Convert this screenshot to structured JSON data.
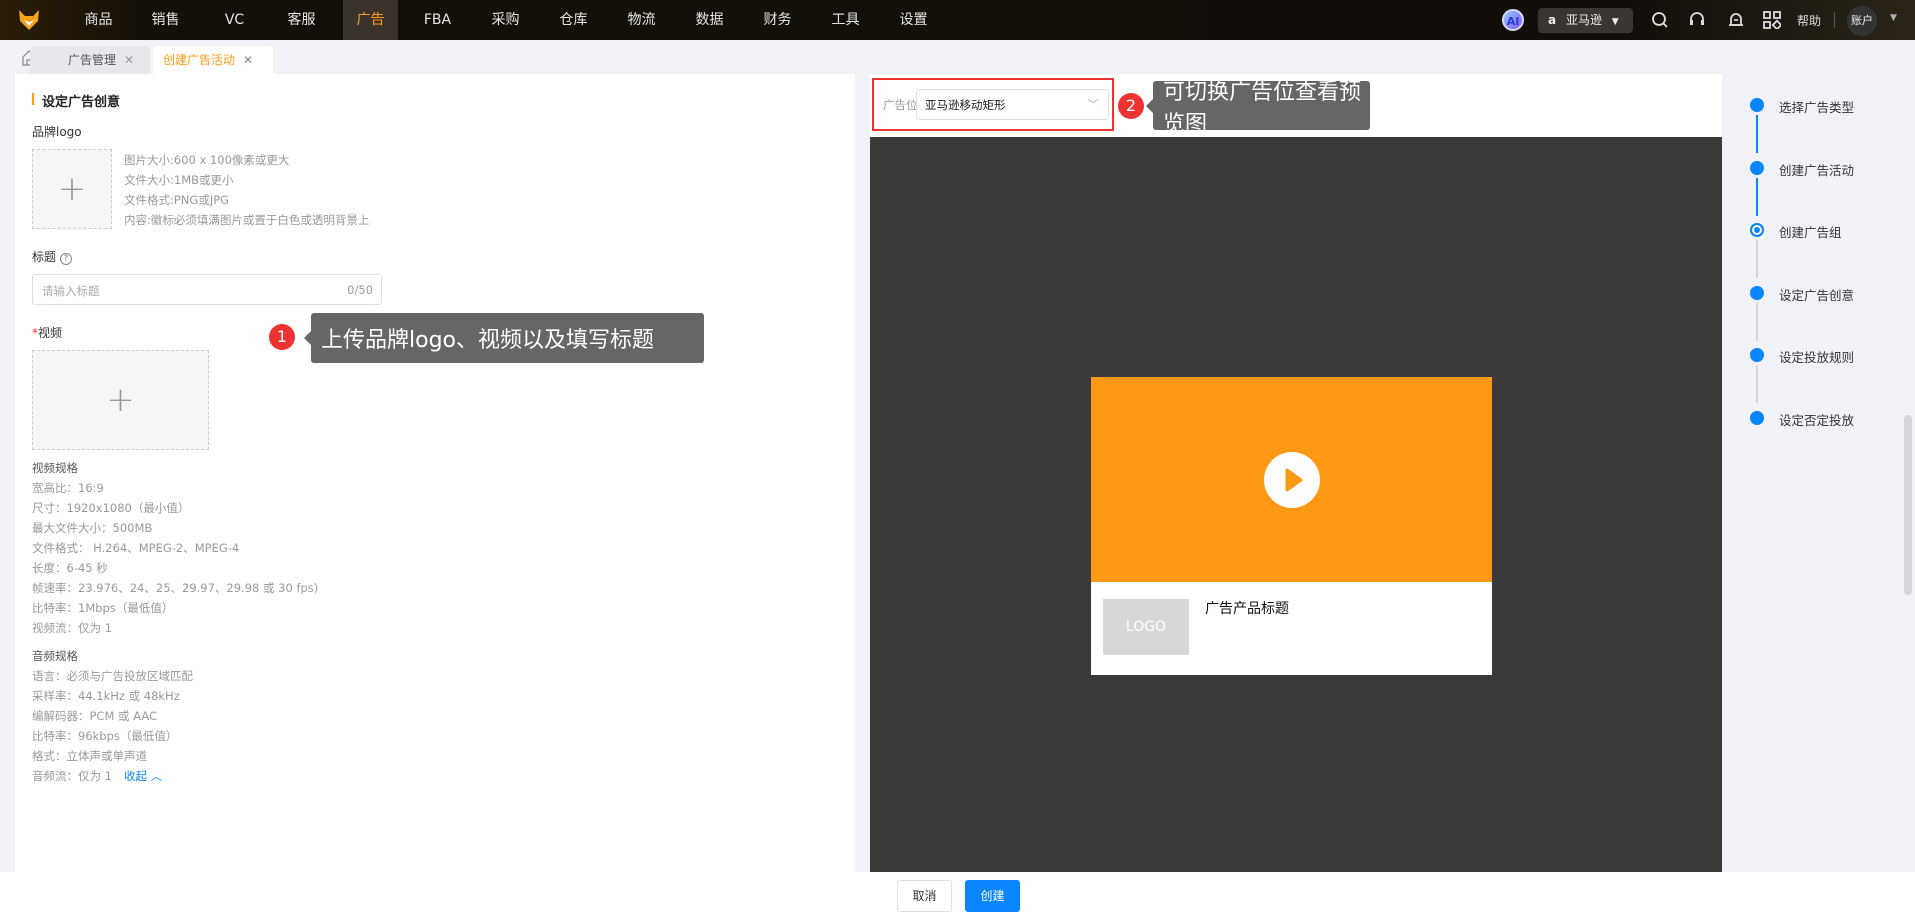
{
  "nav": {
    "items": [
      "商品",
      "销售",
      "VC",
      "客服",
      "广告",
      "FBA",
      "采购",
      "仓库",
      "物流",
      "数据",
      "财务",
      "工具",
      "设置"
    ],
    "active": "广告",
    "ai": "AI",
    "store": "亚马逊",
    "help": "帮助",
    "account": "账户"
  },
  "tabs": [
    {
      "label": "广告管理"
    },
    {
      "label": "创建广告活动"
    }
  ],
  "form": {
    "section_title": "设定广告创意",
    "logo_label": "品牌logo",
    "logo_specs": [
      "图片大小:600 x 100像素或更大",
      "文件大小:1MB或更小",
      "文件格式:PNG或JPG",
      "内容:徽标必须填满图片或置于白色或透明背景上"
    ],
    "title_label": "标题",
    "title_placeholder": "请输入标题",
    "title_count": "0/50",
    "video_required": "*",
    "video_label": "视频",
    "video_spec_title": "视频规格",
    "video_specs": [
      "宽高比：16:9",
      "尺寸：1920x1080（最小值）",
      "最大文件大小：500MB",
      "文件格式： H.264、MPEG-2、MPEG-4",
      "长度：6-45 秒",
      "帧速率：23.976、24、25、29.97、29.98 或 30 fps)",
      "比特率：1Mbps（最低值）",
      "视频流：仅为 1"
    ],
    "audio_spec_title": "音频规格",
    "audio_specs": [
      "语言：必须与广告投放区域匹配",
      "采样率：44.1kHz 或 48kHz",
      "编解码器：PCM 或 AAC",
      "比特率：96kbps（最低值）",
      "格式：立体声或单声道",
      "音频流：仅为 1"
    ],
    "collapse": "收起"
  },
  "callouts": [
    {
      "num": "1",
      "text": "上传品牌logo、视频以及填写标题"
    },
    {
      "num": "2",
      "text": "可切换广告位查看预览图"
    }
  ],
  "preview": {
    "placement_label": "广告位",
    "placement_value": "亚马逊移动矩形",
    "logo": "LOGO",
    "product_title": "广告产品标题",
    "video_color": "#ff9814"
  },
  "steps": [
    {
      "label": "选择广告类型",
      "state": "done"
    },
    {
      "label": "创建广告活动",
      "state": "done"
    },
    {
      "label": "创建广告组",
      "state": "current"
    },
    {
      "label": "设定广告创意",
      "state": "todo"
    },
    {
      "label": "设定投放规则",
      "state": "todo"
    },
    {
      "label": "设定否定投放",
      "state": "todo"
    }
  ],
  "footer": {
    "cancel": "取消",
    "create": "创建"
  },
  "colors": {
    "accent": "#0a84ff",
    "brand": "#ff9a1a",
    "callout_red": "#ee3333"
  }
}
